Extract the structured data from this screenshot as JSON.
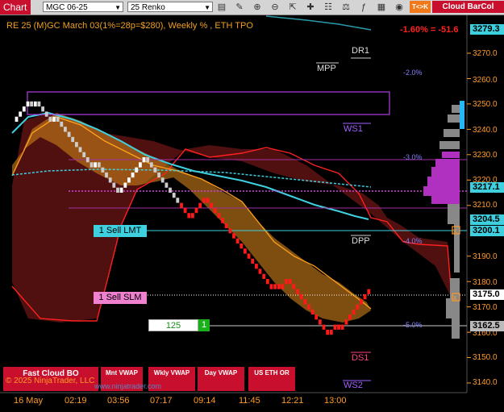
{
  "toolbar": {
    "chart_label": "Chart",
    "instrument": "MGC 06-25",
    "bar_type": "25 Renko",
    "tck_label": "T<>K",
    "cloud_label": "Cloud",
    "barcol_label": "BarCol"
  },
  "header": {
    "title": "RE 25 (M)GC March 03(1%=28p=$280), Weekly % , ETH TPO",
    "pct_change": "-1.60% = -51.6"
  },
  "colors": {
    "bull_bar": "#ffffff",
    "bear_bar": "#ff1a1a",
    "cyan_line": "#3fd0e0",
    "orange_cloud": "#d08a20",
    "red_cloud": "#7a1a1a",
    "magenta": "#c040e0",
    "axis_text": "#ff9a28"
  },
  "axis": {
    "y_ticks": [
      "3270.0",
      "3260.0",
      "3250.0",
      "3240.0",
      "3230.0",
      "3220.0",
      "3210.0",
      "3190.0",
      "3180.0",
      "3170.0",
      "3160.0",
      "3150.0",
      "3140.0"
    ],
    "x_ticks": [
      "16 May",
      "02:19",
      "03:56",
      "07:17",
      "09:14",
      "11:45",
      "12:21",
      "13:00"
    ]
  },
  "price_tags": {
    "p1": "3279.3",
    "p2": "3217.1",
    "p3": "3204.5",
    "p4": "3200.1",
    "p5": "3175.0",
    "p6": "3162.5"
  },
  "levels": {
    "dr1": "DR1",
    "mpp": "MPP",
    "ws1": "WS1",
    "dpp": "DPP",
    "ds1": "DS1",
    "ws2": "WS2"
  },
  "pct_levels": {
    "m2": "-2.0%",
    "m3": "-3.0%",
    "m4": "-4.0%",
    "m5": "-5.0%"
  },
  "orders": {
    "sell_lmt": "1 Sell LMT",
    "sell_slm": "1 Sell SLM",
    "qty": "125",
    "qty_count": "1"
  },
  "bottom_buttons": {
    "fast_cloud": "Fast Cloud BO",
    "mnt_vwap": "Mnt VWAP",
    "wkly_vwap": "Wkly VWAP",
    "day_vwap": "Day VWAP",
    "us_eth": "US ETH OR"
  },
  "footer": {
    "copyright": "© 2025 NinjaTrader, LLC",
    "watermark": "www.ninjatrader.com"
  },
  "chart_data": {
    "type": "renko",
    "instrument": "MGC 06-25",
    "brick_size": "25 Renko",
    "ylim": [
      3135,
      3285
    ],
    "y_ticks": [
      3270,
      3260,
      3250,
      3240,
      3230,
      3220,
      3210,
      3190,
      3180,
      3170,
      3160,
      3150,
      3140
    ],
    "x_ticks": [
      "16 May",
      "02:19",
      "03:56",
      "07:17",
      "09:14",
      "11:45",
      "12:21",
      "13:00"
    ],
    "bricks": [
      3243,
      3245,
      3247,
      3249,
      3251,
      3249,
      3251,
      3249,
      3247,
      3245,
      3243,
      3245,
      3243,
      3241,
      3239,
      3237,
      3235,
      3233,
      3231,
      3229,
      3227,
      3225,
      3227,
      3225,
      3223,
      3221,
      3219,
      3217,
      3215,
      3217,
      3219,
      3221,
      3223,
      3225,
      3227,
      3229,
      3227,
      3225,
      3223,
      3221,
      3219,
      3217,
      3215,
      3213,
      3211,
      3209,
      3207,
      3205,
      3207,
      3209,
      3211,
      3213,
      3211,
      3209,
      3207,
      3205,
      3203,
      3201,
      3199,
      3197,
      3195,
      3193,
      3191,
      3189,
      3187,
      3185,
      3183,
      3181,
      3179,
      3177,
      3179,
      3177,
      3179,
      3181,
      3179,
      3177,
      3175,
      3173,
      3171,
      3169,
      3167,
      3165,
      3163,
      3161,
      3159,
      3161,
      3163,
      3161,
      3163,
      3165,
      3167,
      3169,
      3171,
      3173,
      3175,
      3177
    ],
    "horizontal_levels": [
      {
        "label": "DR1",
        "price": 3267
      },
      {
        "label": "MPP",
        "price": 3262
      },
      {
        "label": "WS1",
        "price": 3237
      },
      {
        "label": "DPP",
        "price": 3193
      },
      {
        "label": "DS1",
        "price": 3148
      },
      {
        "label": "WS2",
        "price": 3135
      }
    ],
    "pct_levels": [
      {
        "label": "-2.0%",
        "price": 3259
      },
      {
        "label": "-3.0%",
        "price": 3228
      },
      {
        "label": "-4.0%",
        "price": 3200.1
      },
      {
        "label": "-5.0%",
        "price": 3162.5
      }
    ],
    "orders": [
      {
        "label": "1 Sell LMT",
        "price": 3200.1
      },
      {
        "label": "1 Sell SLM",
        "price": 3175.0
      }
    ],
    "price_markers": [
      3279.3,
      3217.1,
      3204.5,
      3200.1,
      3175.0,
      3162.5
    ],
    "last_change": "-1.60% = -51.6"
  }
}
